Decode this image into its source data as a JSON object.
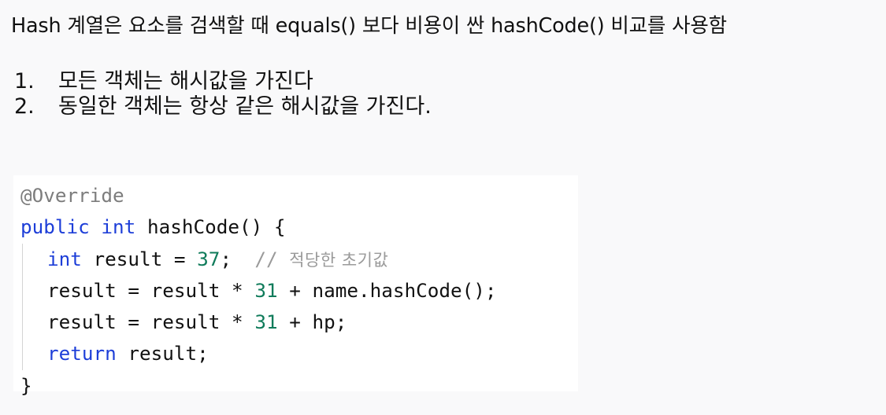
{
  "heading": "Hash 계열은 요소를 검색할 때 equals() 보다 비용이 싼 hashCode() 비교를 사용함",
  "rules": [
    {
      "number": "1.",
      "text": "모든 객체는 해시값을 가진다"
    },
    {
      "number": "2.",
      "text": "동일한 객체는 항상 같은 해시값을 가진다."
    }
  ],
  "code": {
    "annotation": "@Override",
    "signature": {
      "modifier": "public",
      "return_type": "int",
      "rest": " hashCode() {"
    },
    "line1": {
      "type": "int",
      "before_number": " result = ",
      "number": "37",
      "after_number": ";  ",
      "comment_slashes": "// ",
      "comment_text": "적당한 초기값"
    },
    "line2": {
      "before_number": "result = result * ",
      "number": "31",
      "after_number": " + name.hashCode();"
    },
    "line3": {
      "before_number": "result = result * ",
      "number": "31",
      "after_number": " + hp;"
    },
    "line4": {
      "keyword": "return",
      "rest": " result;"
    },
    "closing_brace": "}"
  },
  "colors": {
    "keyword": "#1d3ed8",
    "number": "#0f7b5a",
    "comment": "#9a9a9a",
    "annotation": "#7d7d7d"
  }
}
